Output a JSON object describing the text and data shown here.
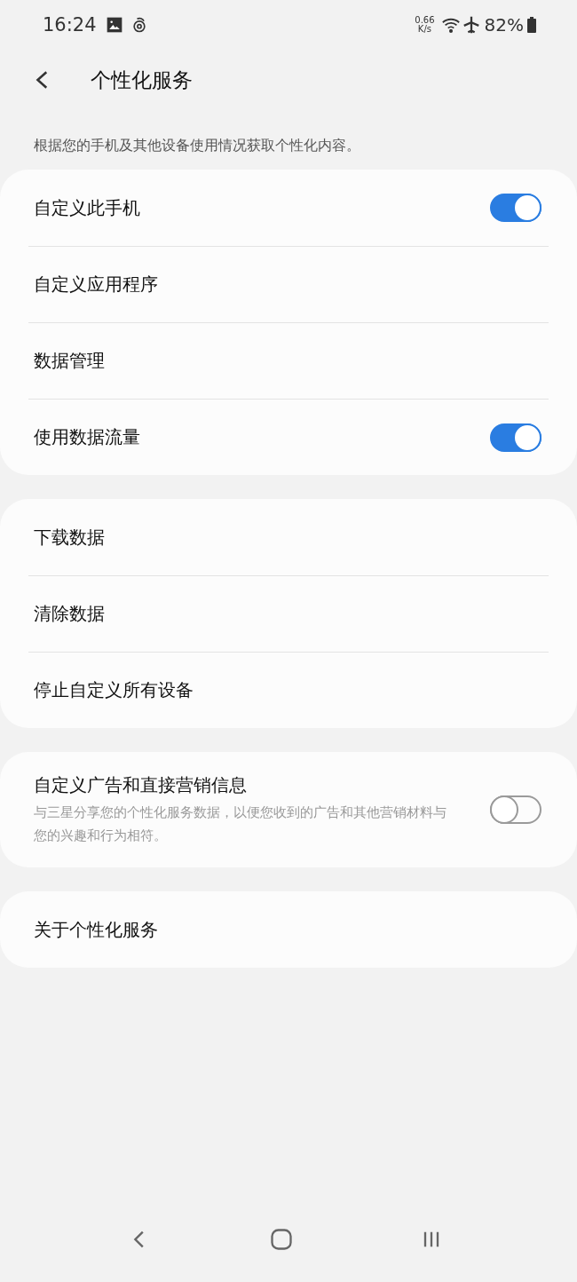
{
  "status_bar": {
    "time": "16:24",
    "speed_value": "0.66",
    "speed_unit": "K/s",
    "battery": "82%"
  },
  "header": {
    "title": "个性化服务"
  },
  "description": "根据您的手机及其他设备使用情况获取个性化内容。",
  "groups": [
    {
      "items": [
        {
          "kind": "toggle",
          "label": "自定义此手机",
          "on": true
        },
        {
          "kind": "link",
          "label": "自定义应用程序"
        },
        {
          "kind": "link",
          "label": "数据管理"
        },
        {
          "kind": "toggle",
          "label": "使用数据流量",
          "on": true
        }
      ]
    },
    {
      "items": [
        {
          "kind": "link",
          "label": "下载数据"
        },
        {
          "kind": "link",
          "label": "清除数据"
        },
        {
          "kind": "link",
          "label": "停止自定义所有设备"
        }
      ]
    },
    {
      "items": [
        {
          "kind": "toggle",
          "label": "自定义广告和直接营销信息",
          "subtitle": "与三星分享您的个性化服务数据，以便您收到的广告和其他营销材料与您的兴趣和行为相符。",
          "on": false
        }
      ]
    },
    {
      "items": [
        {
          "kind": "link",
          "label": "关于个性化服务"
        }
      ]
    }
  ]
}
